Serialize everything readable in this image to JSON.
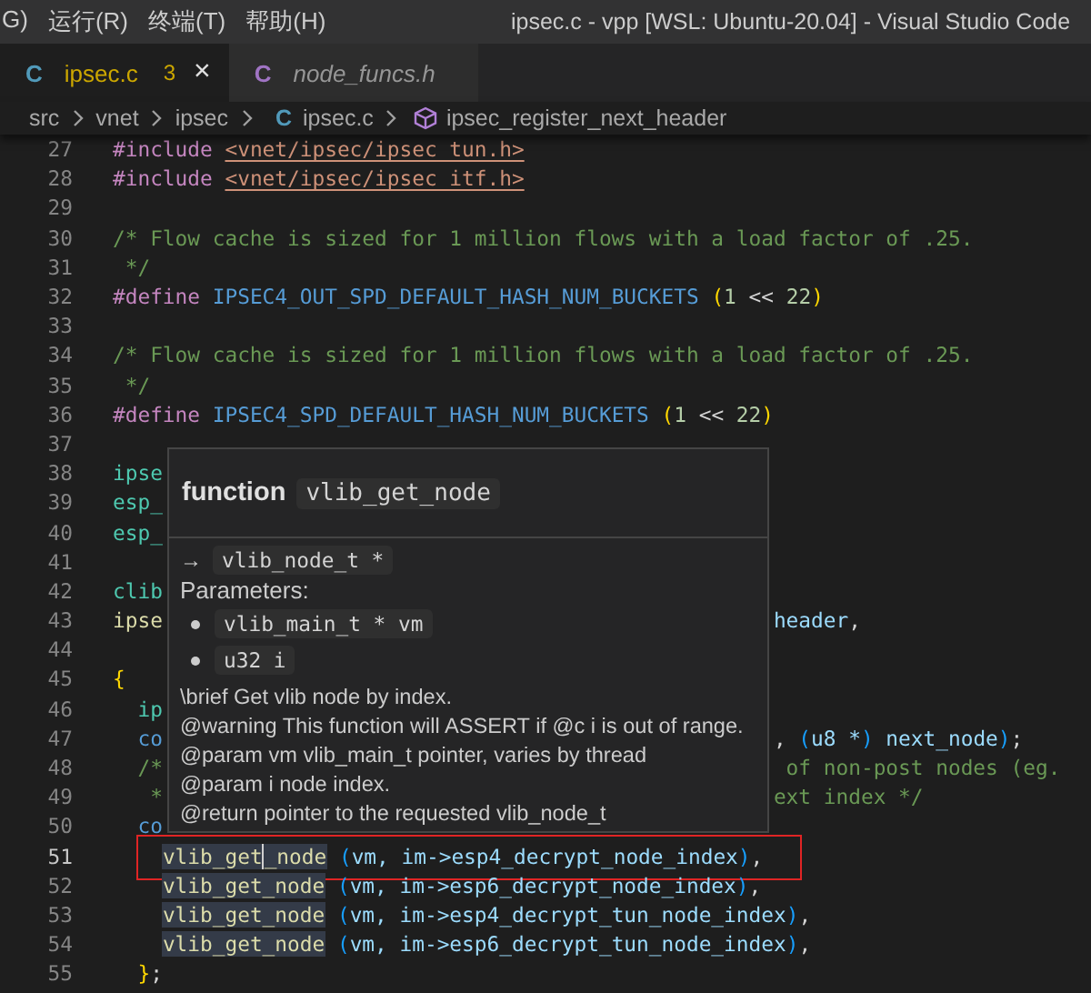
{
  "menu_bar": {
    "items": [
      "G)",
      "运行(R)",
      "终端(T)",
      "帮助(H)"
    ],
    "title": "ipsec.c - vpp [WSL: Ubuntu-20.04] - Visual Studio Code"
  },
  "tabs": [
    {
      "icon": "C",
      "kind": "source",
      "label": "ipsec.c",
      "selected": true,
      "badge": "3",
      "close": "×"
    },
    {
      "icon": "C",
      "kind": "header",
      "label": "node_funcs.h",
      "selected": false
    }
  ],
  "breadcrumb": [
    {
      "kind": "folder",
      "label": "src"
    },
    {
      "kind": "folder",
      "label": "vnet"
    },
    {
      "kind": "folder",
      "label": "ipsec"
    },
    {
      "kind": "file",
      "icon": "C",
      "label": "ipsec.c"
    },
    {
      "kind": "symbol",
      "label": "ipsec_register_next_header"
    }
  ],
  "editor": {
    "lines": [
      {
        "number": "27",
        "tokens": [
          {
            "text": "#include ",
            "kind": "kw"
          },
          {
            "text": "<vnet/ipsec/ipsec_tun.h>",
            "kind": "str"
          }
        ]
      },
      {
        "number": "28",
        "tokens": [
          {
            "text": "#include ",
            "kind": "kw"
          },
          {
            "text": "<vnet/ipsec/ipsec_itf.h>",
            "kind": "str"
          }
        ]
      },
      {
        "number": "29"
      },
      {
        "number": "30",
        "tokens": [
          {
            "text": "/* Flow cache is sized for 1 million flows with a load factor of .25.",
            "kind": "cm"
          }
        ]
      },
      {
        "number": "31",
        "tokens": [
          {
            "text": " */",
            "kind": "cm"
          }
        ]
      },
      {
        "number": "32",
        "tokens": [
          {
            "text": "#define ",
            "kind": "kw"
          },
          {
            "text": "IPSEC4_OUT_SPD_DEFAULT_HASH_NUM_BUCKETS ",
            "kind": "mac"
          },
          {
            "text": "(",
            "kind": "p1"
          },
          {
            "text": "1",
            "kind": "num"
          },
          {
            "text": " << ",
            "kind": "op"
          },
          {
            "text": "22",
            "kind": "num"
          },
          {
            "text": ")",
            "kind": "p1"
          }
        ]
      },
      {
        "number": "33"
      },
      {
        "number": "34",
        "tokens": [
          {
            "text": "/* Flow cache is sized for 1 million flows with a load factor of .25.",
            "kind": "cm"
          }
        ]
      },
      {
        "number": "35",
        "tokens": [
          {
            "text": " */",
            "kind": "cm"
          }
        ]
      },
      {
        "number": "36",
        "tokens": [
          {
            "text": "#define ",
            "kind": "kw"
          },
          {
            "text": "IPSEC4_SPD_DEFAULT_HASH_NUM_BUCKETS ",
            "kind": "mac"
          },
          {
            "text": "(",
            "kind": "p1"
          },
          {
            "text": "1",
            "kind": "num"
          },
          {
            "text": " << ",
            "kind": "op"
          },
          {
            "text": "22",
            "kind": "num"
          },
          {
            "text": ")",
            "kind": "p1"
          }
        ]
      },
      {
        "number": "37"
      },
      {
        "number": "38",
        "tokens": [
          {
            "text": "ipse",
            "kind": "type"
          }
        ]
      },
      {
        "number": "39",
        "tokens": [
          {
            "text": "esp_",
            "kind": "type"
          }
        ]
      },
      {
        "number": "40",
        "tokens": [
          {
            "text": "esp_",
            "kind": "type"
          }
        ]
      },
      {
        "number": "41"
      },
      {
        "number": "42",
        "tokens": [
          {
            "text": "clib",
            "kind": "type"
          }
        ]
      },
      {
        "number": "43",
        "tokens": [
          {
            "text": "ipse",
            "kind": "fn"
          }
        ],
        "right": [
          {
            "text": "header",
            "kind": "var"
          },
          {
            "text": ",",
            "kind": "op"
          }
        ]
      },
      {
        "number": "44"
      },
      {
        "number": "45",
        "tokens": [
          {
            "text": "{",
            "kind": "p1"
          }
        ]
      },
      {
        "number": "46",
        "tokens": [
          {
            "text": "  ip",
            "kind": "type"
          }
        ]
      },
      {
        "number": "47",
        "tokens": [
          {
            "text": "  co",
            "kind": "key"
          }
        ],
        "right": [
          {
            "text": ", ",
            "kind": "op"
          },
          {
            "text": "(",
            "kind": "p2"
          },
          {
            "text": "u8 *",
            "kind": "var"
          },
          {
            "text": ")",
            "kind": "p2"
          },
          {
            "text": " next_node",
            "kind": "var"
          },
          {
            "text": ")",
            "kind": "p2"
          },
          {
            "text": ";",
            "kind": "op"
          }
        ]
      },
      {
        "number": "48",
        "tokens": [
          {
            "text": "  /*",
            "kind": "cm"
          }
        ],
        "right": [
          {
            "text": " of non-post nodes (eg.",
            "kind": "cm"
          }
        ]
      },
      {
        "number": "49",
        "tokens": [
          {
            "text": "   *",
            "kind": "cm"
          }
        ],
        "right": [
          {
            "text": "ext index */",
            "kind": "cm"
          }
        ]
      },
      {
        "number": "50",
        "tokens": [
          {
            "text": "  co",
            "kind": "key"
          }
        ]
      },
      {
        "number": "51",
        "current": true,
        "boxed": true,
        "tokens": [
          {
            "text": "    vlib_get",
            "kind": "fn",
            "hl": true
          },
          {
            "text": "_node",
            "kind": "fn",
            "hl": true,
            "cursor": true
          },
          {
            "text": " (",
            "kind": "p2"
          },
          {
            "text": "vm, im->esp4_decrypt_node_index",
            "kind": "var"
          },
          {
            "text": ")",
            "kind": "p2"
          },
          {
            "text": ",",
            "kind": "op"
          }
        ]
      },
      {
        "number": "52",
        "tokens": [
          {
            "text": "    vlib_get_node",
            "kind": "fn",
            "hl": true
          },
          {
            "text": " (",
            "kind": "p2"
          },
          {
            "text": "vm, im->esp6_decrypt_node_index",
            "kind": "var"
          },
          {
            "text": ")",
            "kind": "p2"
          },
          {
            "text": ",",
            "kind": "op"
          }
        ]
      },
      {
        "number": "53",
        "tokens": [
          {
            "text": "    vlib_get_node",
            "kind": "fn",
            "hl": true
          },
          {
            "text": " (",
            "kind": "p2"
          },
          {
            "text": "vm, im->esp4_decrypt_tun_node_index",
            "kind": "var"
          },
          {
            "text": ")",
            "kind": "p2"
          },
          {
            "text": ",",
            "kind": "op"
          }
        ]
      },
      {
        "number": "54",
        "tokens": [
          {
            "text": "    vlib_get_node",
            "kind": "fn",
            "hl": true
          },
          {
            "text": " (",
            "kind": "p2"
          },
          {
            "text": "vm, im->esp6_decrypt_tun_node_index",
            "kind": "var"
          },
          {
            "text": ")",
            "kind": "p2"
          },
          {
            "text": ",",
            "kind": "op"
          }
        ]
      },
      {
        "number": "55",
        "tokens": [
          {
            "text": "  }",
            "kind": "p1"
          },
          {
            "text": ";",
            "kind": "op"
          }
        ]
      }
    ]
  },
  "hover": {
    "kind_label": "function",
    "name": "vlib_get_node",
    "arrow": "→",
    "return_type": "vlib_node_t *",
    "params_label": "Parameters:",
    "params": [
      "vlib_main_t * vm",
      "u32 i"
    ],
    "doc": [
      "\\brief Get vlib node by index.",
      "@warning This function will ASSERT if @c i is out of range.",
      "@param vm vlib_main_t pointer, varies by thread",
      "@param i node index.",
      "@return pointer to the requested vlib_node_t"
    ]
  }
}
